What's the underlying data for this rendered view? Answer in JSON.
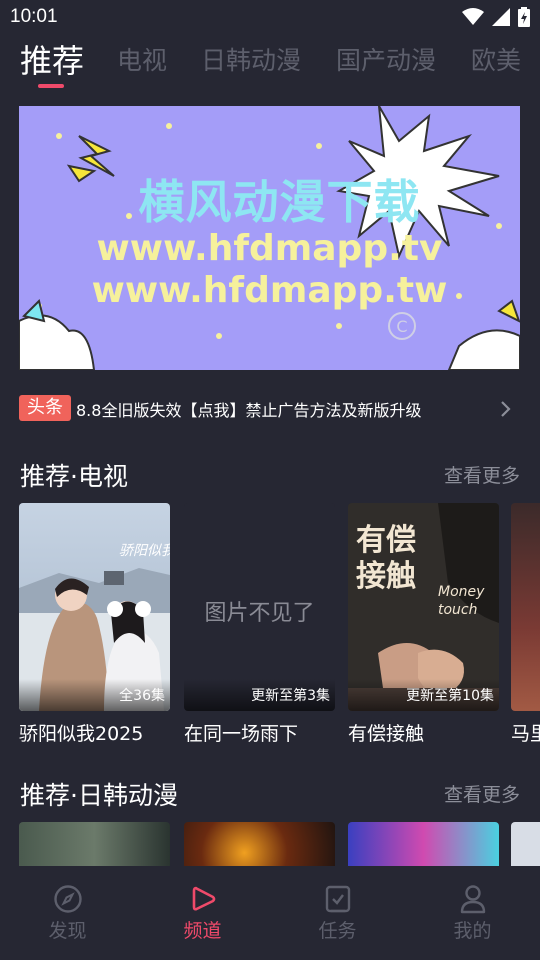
{
  "status_bar": {
    "time": "10:01"
  },
  "category_tabs": [
    {
      "label": "推荐",
      "active": true
    },
    {
      "label": "电视"
    },
    {
      "label": "日韩动漫"
    },
    {
      "label": "国产动漫"
    },
    {
      "label": "欧美"
    }
  ],
  "banner": {
    "title": "横风动漫下载",
    "line1": "www.hfdmapp.tv",
    "line2": "www.hfdmapp.tw",
    "background": "#a49df8"
  },
  "notice": {
    "badge": "头条",
    "text": "8.8全旧版失效【点我】禁止广告方法及新版升级"
  },
  "section_tv": {
    "title": "推荐·电视",
    "more": "查看更多",
    "cards": [
      {
        "title": "骄阳似我2025",
        "tag": "全36集"
      },
      {
        "title": "在同一场雨下",
        "tag": "更新至第3集",
        "missing_text": "图片不见了"
      },
      {
        "title": "有偿接触",
        "tag": "更新至第10集",
        "poster_text": "有偿接触",
        "poster_subtext": "Money touch"
      },
      {
        "title": "马里"
      }
    ]
  },
  "section_anime": {
    "title": "推荐·日韩动漫",
    "more": "查看更多"
  },
  "bottom_nav": [
    {
      "label": "发现",
      "icon": "compass-icon"
    },
    {
      "label": "频道",
      "icon": "play-icon",
      "active": true
    },
    {
      "label": "任务",
      "icon": "task-icon"
    },
    {
      "label": "我的",
      "icon": "profile-icon"
    }
  ],
  "colors": {
    "accent": "#ef4a6a",
    "background": "#262733",
    "badge": "#f0635b"
  }
}
